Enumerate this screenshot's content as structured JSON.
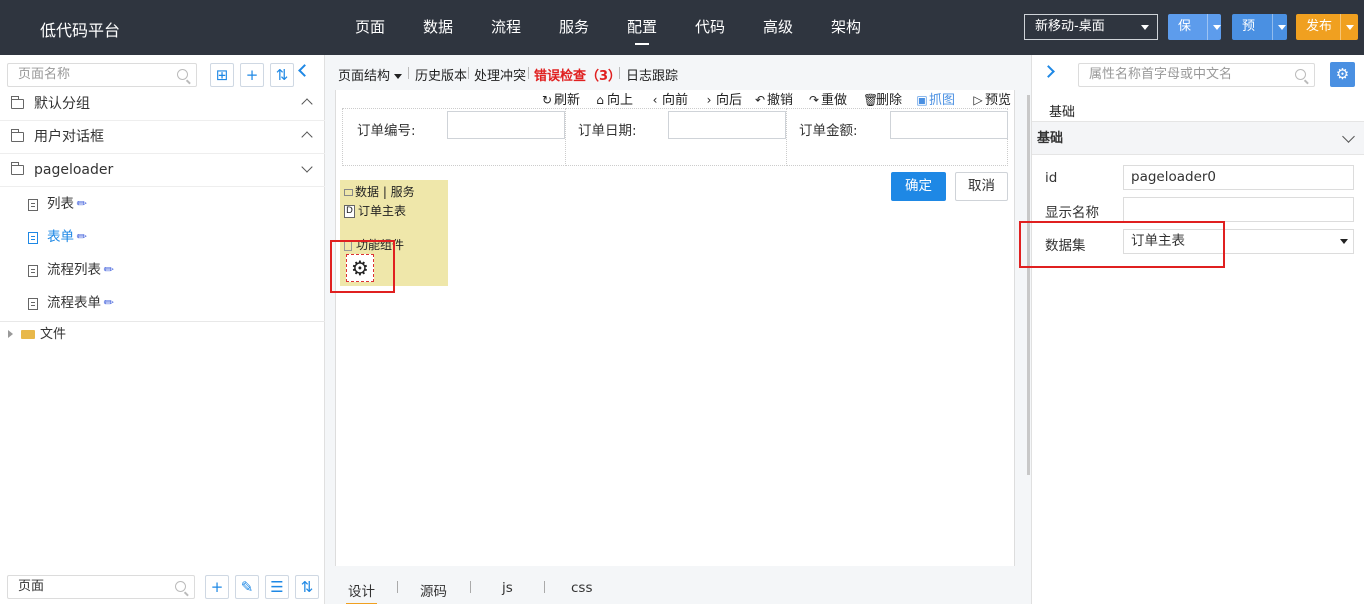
{
  "app": {
    "title": "低代码平台"
  },
  "nav": {
    "items": [
      {
        "label": "页面",
        "active": false
      },
      {
        "label": "数据",
        "active": false
      },
      {
        "label": "流程",
        "active": false
      },
      {
        "label": "服务",
        "active": false
      },
      {
        "label": "配置",
        "active": true
      },
      {
        "label": "代码",
        "active": false
      },
      {
        "label": "高级",
        "active": false
      },
      {
        "label": "架构",
        "active": false
      }
    ],
    "device_select": "新移动-桌面",
    "save": "保存",
    "preview": "预览",
    "publish": "发布"
  },
  "left": {
    "search_placeholder": "页面名称",
    "groups": [
      {
        "label": "默认分组",
        "expanded": false
      },
      {
        "label": "用户对话框",
        "expanded": false
      },
      {
        "label": "pageloader",
        "expanded": true
      }
    ],
    "items": [
      {
        "label": "列表",
        "active": false
      },
      {
        "label": "表单",
        "active": true
      },
      {
        "label": "流程列表",
        "active": false
      },
      {
        "label": "流程表单",
        "active": false
      }
    ],
    "file_node": "文件",
    "bottom_search_value": "页面"
  },
  "center": {
    "toolbar": {
      "page_structure": "页面结构",
      "history": "历史版本",
      "conflict": "处理冲突",
      "error_check": "错误检查（3）",
      "log_trace": "日志跟踪"
    },
    "actions": {
      "refresh": "刷新",
      "up": "向上",
      "forward": "向前",
      "backward": "向后",
      "undo": "撤销",
      "redo": "重做",
      "delete": "删除",
      "screenshot": "抓图",
      "preview": "预览"
    },
    "form": {
      "order_no": "订单编号:",
      "order_date": "订单日期:",
      "order_amount": "订单金额:"
    },
    "confirm": "确定",
    "cancel": "取消",
    "component": {
      "header": "数据 | 服务",
      "data_item": "订单主表",
      "func_label": "功能组件"
    },
    "tabs": [
      {
        "label": "设计",
        "active": true
      },
      {
        "label": "源码",
        "active": false
      },
      {
        "label": "js",
        "active": false
      },
      {
        "label": "css",
        "active": false
      }
    ]
  },
  "right": {
    "search_placeholder": "属性名称首字母或中文名",
    "tab": "基础",
    "section": "基础",
    "props": [
      {
        "label": "id",
        "value": "pageloader0"
      },
      {
        "label": "显示名称",
        "value": ""
      },
      {
        "label": "数据集",
        "value": "订单主表"
      }
    ]
  },
  "colors": {
    "topbar": "#2f353f",
    "accent": "#1e88e5",
    "publish": "#f0a020",
    "highlight": "#e02020",
    "component_bg": "#efe7aa"
  }
}
